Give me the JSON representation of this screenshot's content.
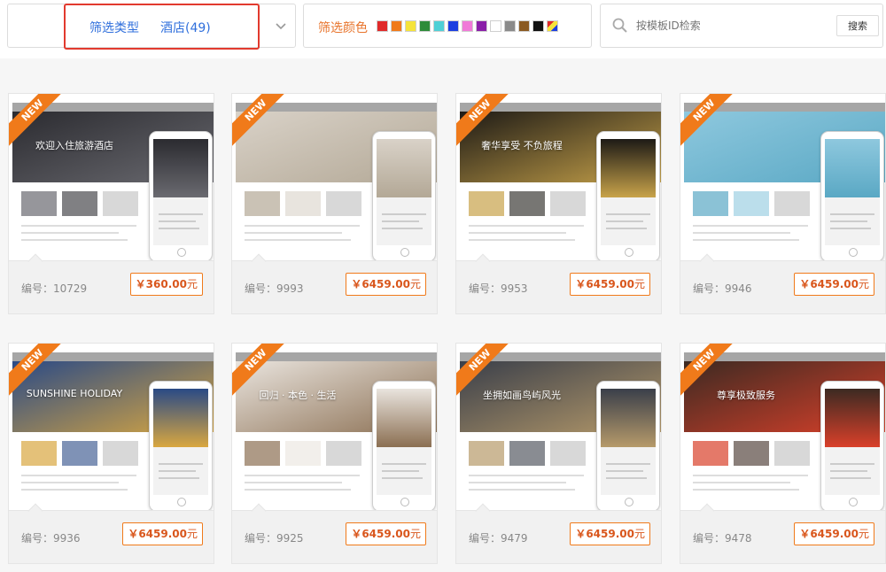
{
  "filters": {
    "type_label": "筛选类型",
    "type_value": "酒店(49)",
    "color_label": "筛选颜色",
    "colors": [
      "#e02a2a",
      "#f07a1a",
      "#f5e33b",
      "#2e8b3a",
      "#4fd0d6",
      "#1c3fe0",
      "#f07ad8",
      "#8a1fa8",
      "#ffffff",
      "#8a8a8a",
      "#8a5a22",
      "#111111",
      "multi"
    ],
    "search_placeholder": "按模板ID检索",
    "search_button": "搜索"
  },
  "templates": [
    {
      "code": "编号：10729",
      "price": "￥360.00",
      "unit": "元",
      "badge": "NEW",
      "hero": "欢迎入住旅游酒店",
      "theme": "#2b2b30",
      "accent": "#6a6a70"
    },
    {
      "code": "编号：9993",
      "price": "￥6459.00",
      "unit": "元",
      "badge": "NEW",
      "hero": "",
      "theme": "#d9d2c8",
      "accent": "#b3a896"
    },
    {
      "code": "编号：9953",
      "price": "￥6459.00",
      "unit": "元",
      "badge": "NEW",
      "hero": "奢华享受 不负旅程",
      "theme": "#1d1a16",
      "accent": "#c8a34a"
    },
    {
      "code": "编号：9946",
      "price": "￥6459.00",
      "unit": "元",
      "badge": "NEW",
      "hero": "",
      "theme": "#8ec8de",
      "accent": "#5aa8c4"
    },
    {
      "code": "编号：9936",
      "price": "￥6459.00",
      "unit": "元",
      "badge": "NEW",
      "hero": "SUNSHINE HOLIDAY",
      "theme": "#2a4a86",
      "accent": "#d9a740"
    },
    {
      "code": "编号：9925",
      "price": "￥6459.00",
      "unit": "元",
      "badge": "NEW",
      "hero": "回归 · 本色 · 生活",
      "theme": "#e9e4de",
      "accent": "#8b6f52"
    },
    {
      "code": "编号：9479",
      "price": "￥6459.00",
      "unit": "元",
      "badge": "NEW",
      "hero": "坐拥如画鸟屿风光",
      "theme": "#3a3f4a",
      "accent": "#b69a6a"
    },
    {
      "code": "编号：9478",
      "price": "￥6459.00",
      "unit": "元",
      "badge": "NEW",
      "hero": "尊享极致服务",
      "theme": "#3c2a22",
      "accent": "#d9402a"
    }
  ]
}
